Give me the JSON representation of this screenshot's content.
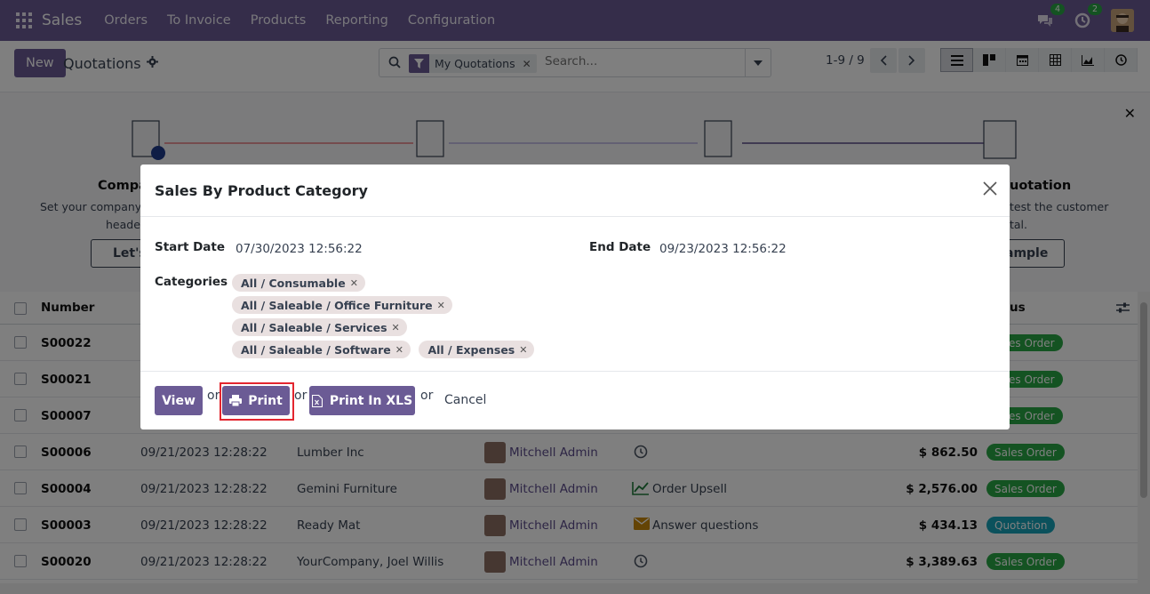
{
  "navbar": {
    "brand": "Sales",
    "menu": [
      "Orders",
      "To Invoice",
      "Products",
      "Reporting",
      "Configuration"
    ],
    "messages_count": "4",
    "activities_count": "2"
  },
  "control": {
    "new_label": "New",
    "title": "Quotations",
    "facet_label": "My Quotations",
    "search_placeholder": "Search...",
    "pager": "1-9 / 9"
  },
  "helper": {
    "step1_title": "Compa",
    "step1_line1": "Set your company's",
    "step1_line2": "header",
    "step1_button": "Let's",
    "step4_title": "uotation",
    "step4_line1": "test the customer",
    "step4_line2": "tal.",
    "step4_button": "ample"
  },
  "list": {
    "col_number": "Number",
    "col_status": "us",
    "rows": [
      {
        "number": "S00022",
        "date": "",
        "customer": "",
        "salesperson": "",
        "activity": "",
        "total": "",
        "status": "es Order",
        "status_color": "#28a745"
      },
      {
        "number": "S00021",
        "date": "",
        "customer": "",
        "salesperson": "",
        "activity": "",
        "total": "",
        "status": "es Order",
        "status_color": "#28a745"
      },
      {
        "number": "S00007",
        "date": "",
        "customer": "",
        "salesperson": "",
        "activity": "",
        "total": "",
        "status": "es Order",
        "status_color": "#28a745"
      },
      {
        "number": "S00006",
        "date": "09/21/2023 12:28:22",
        "customer": "Lumber Inc",
        "salesperson": "Mitchell Admin",
        "activity": "",
        "activity_icon": "clock-icon",
        "total": "$ 862.50",
        "status": "Sales Order",
        "status_color": "#28a745"
      },
      {
        "number": "S00004",
        "date": "09/21/2023 12:28:22",
        "customer": "Gemini Furniture",
        "salesperson": "Mitchell Admin",
        "activity": "Order Upsell",
        "activity_icon": "chart-icon",
        "total": "$ 2,576.00",
        "status": "Sales Order",
        "status_color": "#28a745"
      },
      {
        "number": "S00003",
        "date": "09/21/2023 12:28:22",
        "customer": "Ready Mat",
        "salesperson": "Mitchell Admin",
        "activity": "Answer questions",
        "activity_icon": "envelope-icon",
        "total": "$ 434.13",
        "status": "Quotation",
        "status_color": "#17a2b8"
      },
      {
        "number": "S00020",
        "date": "09/21/2023 12:28:22",
        "customer": "YourCompany, Joel Willis",
        "salesperson": "Mitchell Admin",
        "activity": "",
        "activity_icon": "clock-icon",
        "total": "$ 3,389.63",
        "status": "Sales Order",
        "status_color": "#28a745"
      }
    ]
  },
  "modal": {
    "title": "Sales By Product Category",
    "start_date_label": "Start Date",
    "start_date_value": "07/30/2023 12:56:22",
    "end_date_label": "End Date",
    "end_date_value": "09/23/2023 12:56:22",
    "categories_label": "Categories",
    "categories": [
      "All / Consumable",
      "All / Saleable / Office Furniture",
      "All / Saleable / Services",
      "All / Saleable / Software",
      "All / Expenses"
    ],
    "view_label": "View",
    "print_label": "Print",
    "print_xls_label": "Print In XLS",
    "or_text": "or",
    "cancel_label": "Cancel"
  }
}
